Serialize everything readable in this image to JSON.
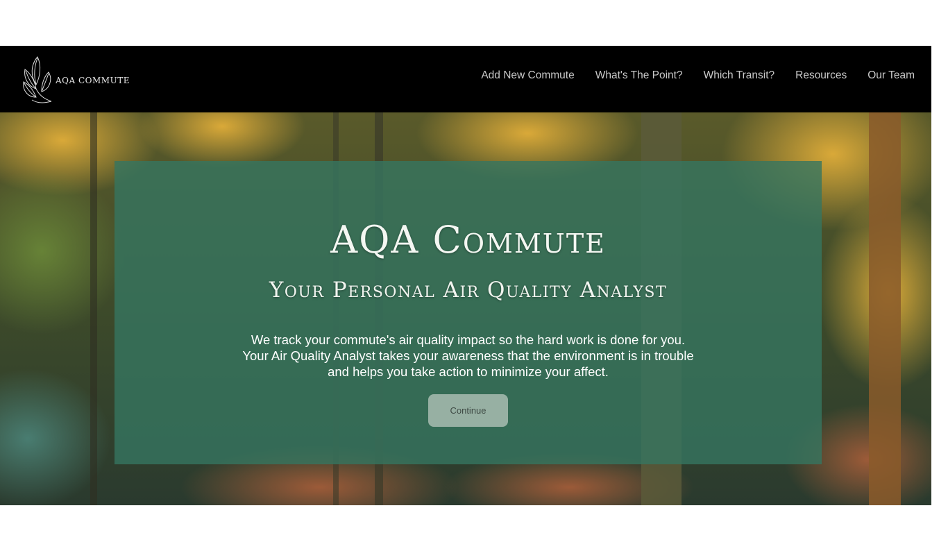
{
  "header": {
    "logo_text": "AQA COMMUTE",
    "nav": [
      {
        "label": "Add New Commute"
      },
      {
        "label": "What's The Point?"
      },
      {
        "label": "Which Transit?"
      },
      {
        "label": "Resources"
      },
      {
        "label": "Our Team"
      }
    ]
  },
  "hero": {
    "title": "AQA Commute",
    "subtitle": "Your Personal Air Quality Analyst",
    "body_lines": [
      "We track your commute's air quality impact so the hard work is done for you.",
      "Your Air Quality Analyst takes your awareness that the environment is in trouble",
      "and helps you take action to minimize your affect."
    ],
    "button_label": "Continue"
  },
  "colors": {
    "header_bg": "#000000",
    "overlay": "#36765f",
    "nav_text": "#c9c9c9"
  },
  "icons": {
    "logo": "leaf-logo-icon"
  }
}
